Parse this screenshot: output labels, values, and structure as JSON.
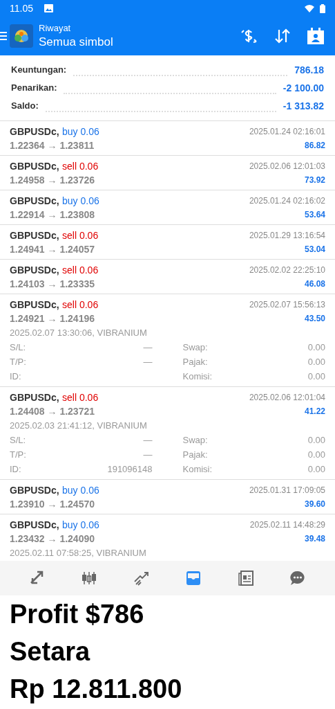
{
  "status_bar": {
    "time": "11.05"
  },
  "app_bar": {
    "subtitle": "Riwayat",
    "title": "Semua simbol"
  },
  "summary": [
    {
      "label": "Keuntungan:",
      "value": "786.18"
    },
    {
      "label": "Penarikan:",
      "value": "-2 100.00"
    },
    {
      "label": "Saldo:",
      "value": "-1 313.82"
    }
  ],
  "trades": [
    {
      "symbol": "GBPUSDc,",
      "order": "buy 0.06",
      "kind": "buy",
      "prices": "1.22364 → 1.23811",
      "time": "2025.01.24 02:16:01",
      "profit": "86.82"
    },
    {
      "symbol": "GBPUSDc,",
      "order": "sell 0.06",
      "kind": "sell",
      "prices": "1.24958 → 1.23726",
      "time": "2025.02.06 12:01:03",
      "profit": "73.92"
    },
    {
      "symbol": "GBPUSDc,",
      "order": "buy 0.06",
      "kind": "buy",
      "prices": "1.22914 → 1.23808",
      "time": "2025.01.24 02:16:02",
      "profit": "53.64"
    },
    {
      "symbol": "GBPUSDc,",
      "order": "sell 0.06",
      "kind": "sell",
      "prices": "1.24941 → 1.24057",
      "time": "2025.01.29 13:16:54",
      "profit": "53.04"
    },
    {
      "symbol": "GBPUSDc,",
      "order": "sell 0.06",
      "kind": "sell",
      "prices": "1.24103 → 1.23335",
      "time": "2025.02.02 22:25:10",
      "profit": "46.08"
    },
    {
      "symbol": "GBPUSDc,",
      "order": "sell 0.06",
      "kind": "sell",
      "prices": "1.24921 → 1.24196",
      "time": "2025.02.07 15:56:13",
      "profit": "43.50",
      "details": {
        "opened": "2025.02.07 13:30:06, VIBRANIUM",
        "fields": [
          {
            "label": "S/L:",
            "value": "—"
          },
          {
            "label": "Swap:",
            "value": "0.00"
          },
          {
            "label": "T/P:",
            "value": "—"
          },
          {
            "label": "Pajak:",
            "value": "0.00"
          },
          {
            "label": "ID:"
          },
          {
            "label": "Komisi:",
            "value": "0.00"
          }
        ]
      }
    },
    {
      "symbol": "GBPUSDc,",
      "order": "sell 0.06",
      "kind": "sell",
      "prices": "1.24408 → 1.23721",
      "time": "2025.02.06 12:01:04",
      "profit": "41.22",
      "details": {
        "opened": "2025.02.03 21:41:12, VIBRANIUM",
        "fields": [
          {
            "label": "S/L:",
            "value": "—"
          },
          {
            "label": "Swap:",
            "value": "0.00"
          },
          {
            "label": "T/P:",
            "value": "—"
          },
          {
            "label": "Pajak:",
            "value": "0.00"
          },
          {
            "label": "ID:",
            "value": "191096148"
          },
          {
            "label": "Komisi:",
            "value": "0.00"
          }
        ]
      }
    },
    {
      "symbol": "GBPUSDc,",
      "order": "buy 0.06",
      "kind": "buy",
      "prices": "1.23910 → 1.24570",
      "time": "2025.01.31 17:09:05",
      "profit": "39.60"
    },
    {
      "symbol": "GBPUSDc,",
      "order": "buy 0.06",
      "kind": "buy",
      "prices": "1.23432 → 1.24090",
      "time": "2025.02.11 14:48:29",
      "profit": "39.48",
      "details": {
        "opened": "2025.02.11 07:58:25, VIBRANIUM"
      }
    }
  ],
  "bottom_nav": [
    {
      "kind": "trade",
      "selected": false
    },
    {
      "kind": "chart",
      "selected": false
    },
    {
      "kind": "signals",
      "selected": false
    },
    {
      "kind": "history",
      "selected": true
    },
    {
      "kind": "news",
      "selected": false
    },
    {
      "kind": "chat",
      "selected": false
    }
  ],
  "caption": [
    "Profit $786",
    "Setara",
    "Rp 12.811.800"
  ]
}
